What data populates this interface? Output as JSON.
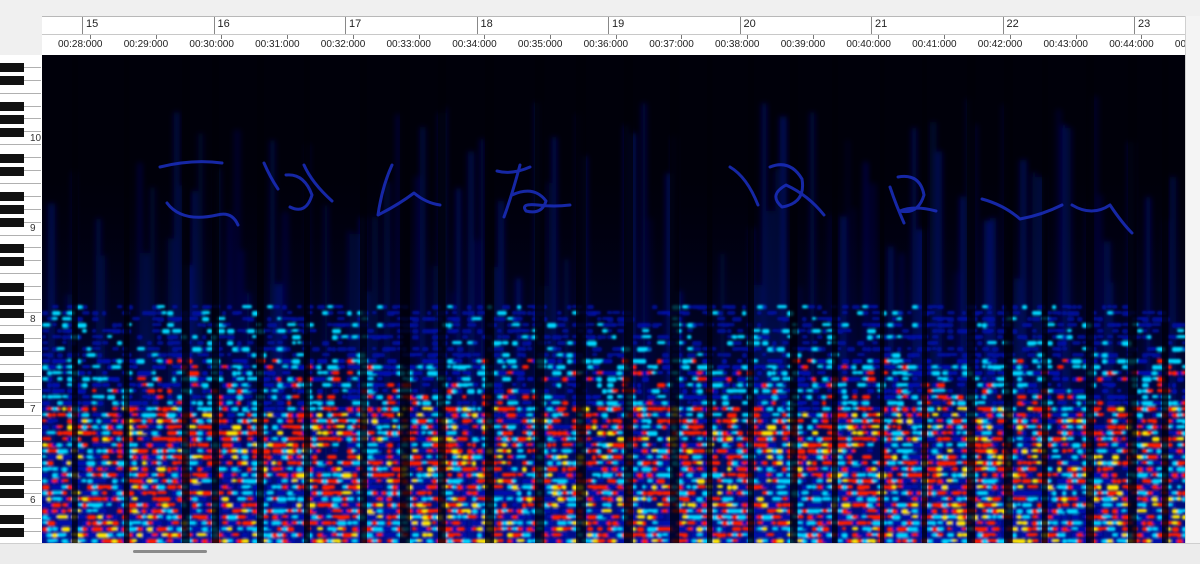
{
  "ruler": {
    "bars": [
      "15",
      "16",
      "17",
      "18",
      "19",
      "20",
      "21",
      "22",
      "23"
    ],
    "times": [
      "00:28:000",
      "00:29:000",
      "00:30:000",
      "00:31:000",
      "00:32:000",
      "00:33:000",
      "00:34:000",
      "00:35:000",
      "00:36:000",
      "00:37:000",
      "00:38:000",
      "00:39:000",
      "00:40:000",
      "00:41:000",
      "00:42:000",
      "00:43:000",
      "00:44:000",
      "00"
    ]
  },
  "keyboard": {
    "octaves": [
      "10",
      "9",
      "8",
      "7",
      "6"
    ]
  },
  "colors": {
    "background": "#00000a",
    "low": "#0010b0",
    "mid": "#00d8ff",
    "high": "#ff1a00",
    "peak": "#ffe600",
    "ink": "#1830c8"
  }
}
